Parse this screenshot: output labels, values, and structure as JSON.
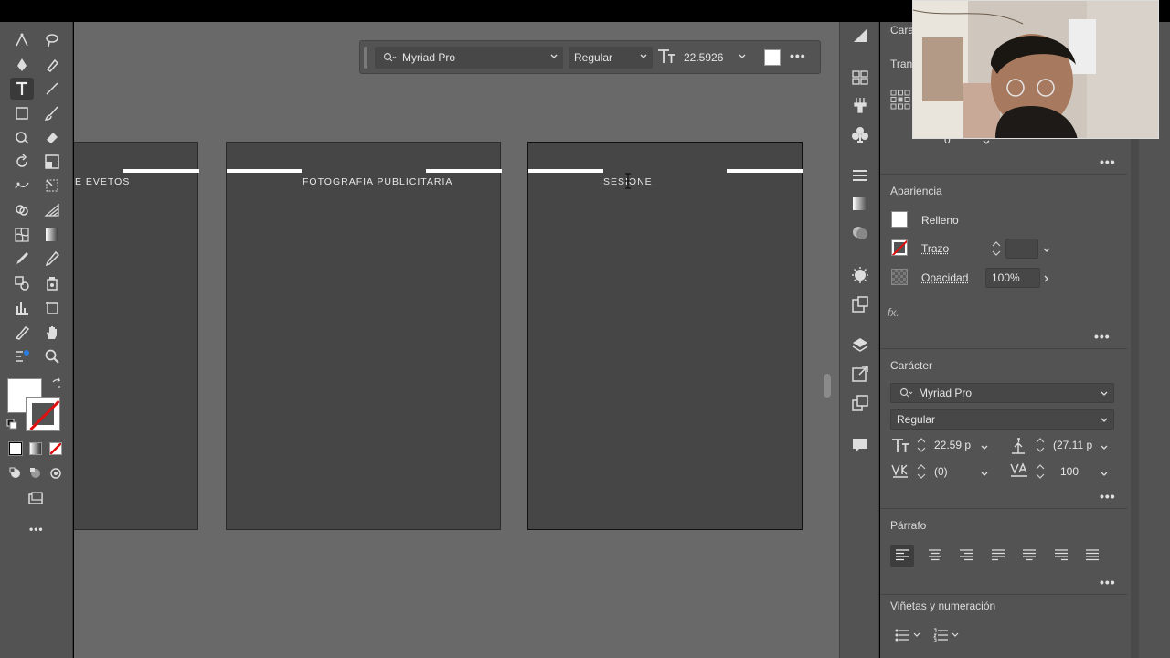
{
  "control_bar": {
    "font_family": "Myriad Pro",
    "font_style": "Regular",
    "font_size": "22.5926"
  },
  "artboards": [
    {
      "title": "E EVETOS"
    },
    {
      "title": "FOTOGRAFIA PUBLICITARIA"
    },
    {
      "title": "SESIONE"
    }
  ],
  "panel": {
    "top_titles": {
      "caracter_truncated": "Cara",
      "transform_truncated": "Tran"
    },
    "transform_value": "0",
    "appearance": {
      "title": "Apariencia",
      "fill_label": "Relleno",
      "stroke_label": "Trazo",
      "stroke_value": "",
      "opacity_label": "Opacidad",
      "opacity_value": "100%",
      "fx_label": "fx."
    },
    "character": {
      "title": "Carácter",
      "font_family": "Myriad Pro",
      "font_style": "Regular",
      "font_size": "22.59 p",
      "leading": "(27.11 p",
      "kerning": "(0)",
      "tracking": "100"
    },
    "paragraph": {
      "title": "Párrafo"
    },
    "bullets": {
      "title": "Viñetas y numeración"
    }
  },
  "colors": {
    "panel_bg": "#535353",
    "canvas_bg": "#696969",
    "artboard_bg": "#464646",
    "none_red": "#e01010"
  }
}
